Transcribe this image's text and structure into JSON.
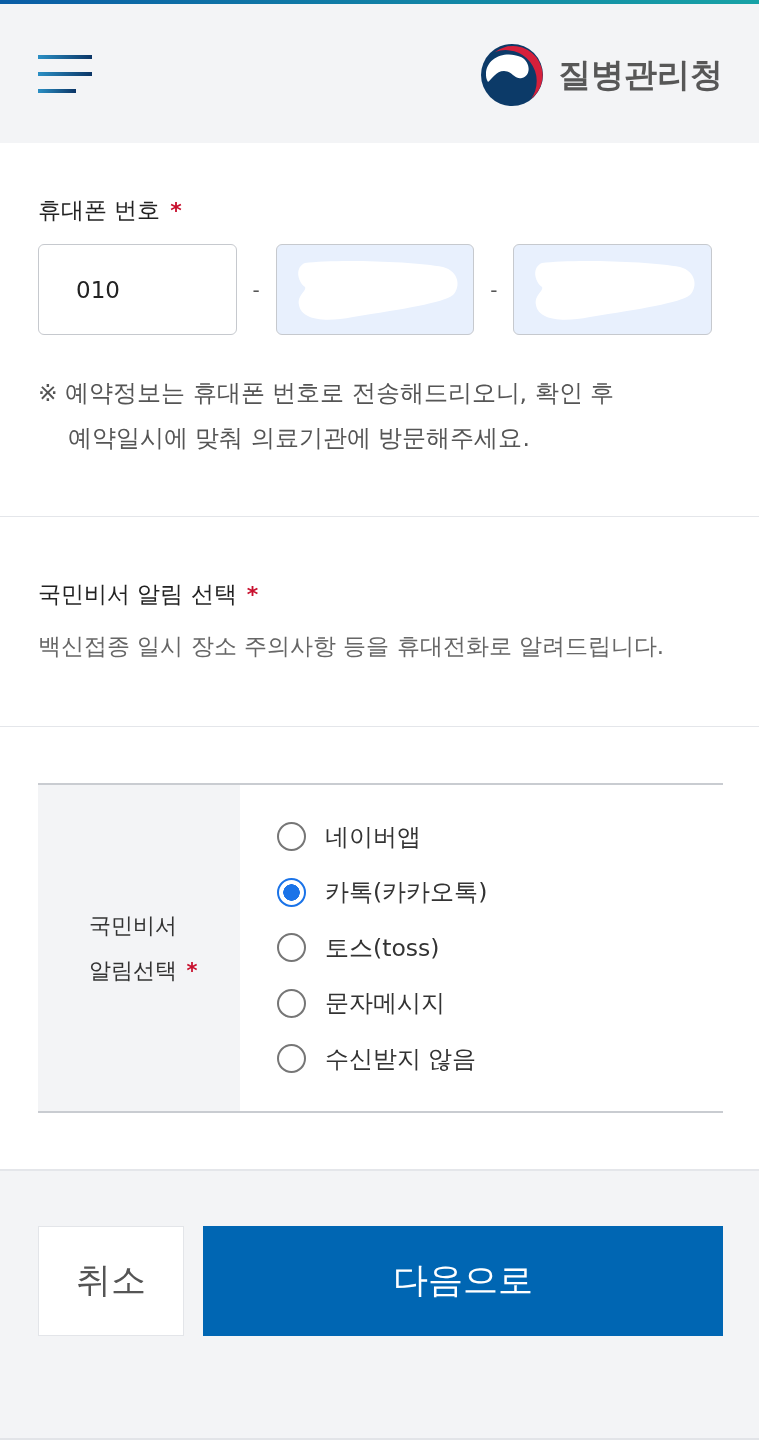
{
  "header": {
    "logo_text": "질병관리청"
  },
  "phone": {
    "label": "휴대폰 번호",
    "required_mark": "*",
    "fields": [
      {
        "value": "010",
        "redacted": false
      },
      {
        "redacted": true
      },
      {
        "redacted": true
      }
    ],
    "separators": [
      "-",
      "-"
    ],
    "note_lines": [
      "※ 예약정보는 휴대폰 번호로 전송해드리오니, 확인 후",
      "예약일시에 맞춰 의료기관에 방문해주세요."
    ]
  },
  "notification": {
    "title": "국민비서 알림 선택",
    "required_mark": "*",
    "description": "백신접종 일시 장소 주의사항 등을 휴대전화로 알려드립니다.",
    "table": {
      "header_lines": [
        "국민비서",
        "알림선택"
      ],
      "required_mark": "*",
      "options": [
        {
          "label": "네이버앱",
          "selected": false
        },
        {
          "label": "카톡(카카오톡)",
          "selected": true
        },
        {
          "label": "토스(toss)",
          "selected": false
        },
        {
          "label": "문자메시지",
          "selected": false
        },
        {
          "label": "수신받지 않음",
          "selected": false
        }
      ]
    }
  },
  "actions": [
    {
      "label": "취소",
      "kind": "secondary"
    },
    {
      "label": "다음으로",
      "kind": "primary"
    }
  ]
}
